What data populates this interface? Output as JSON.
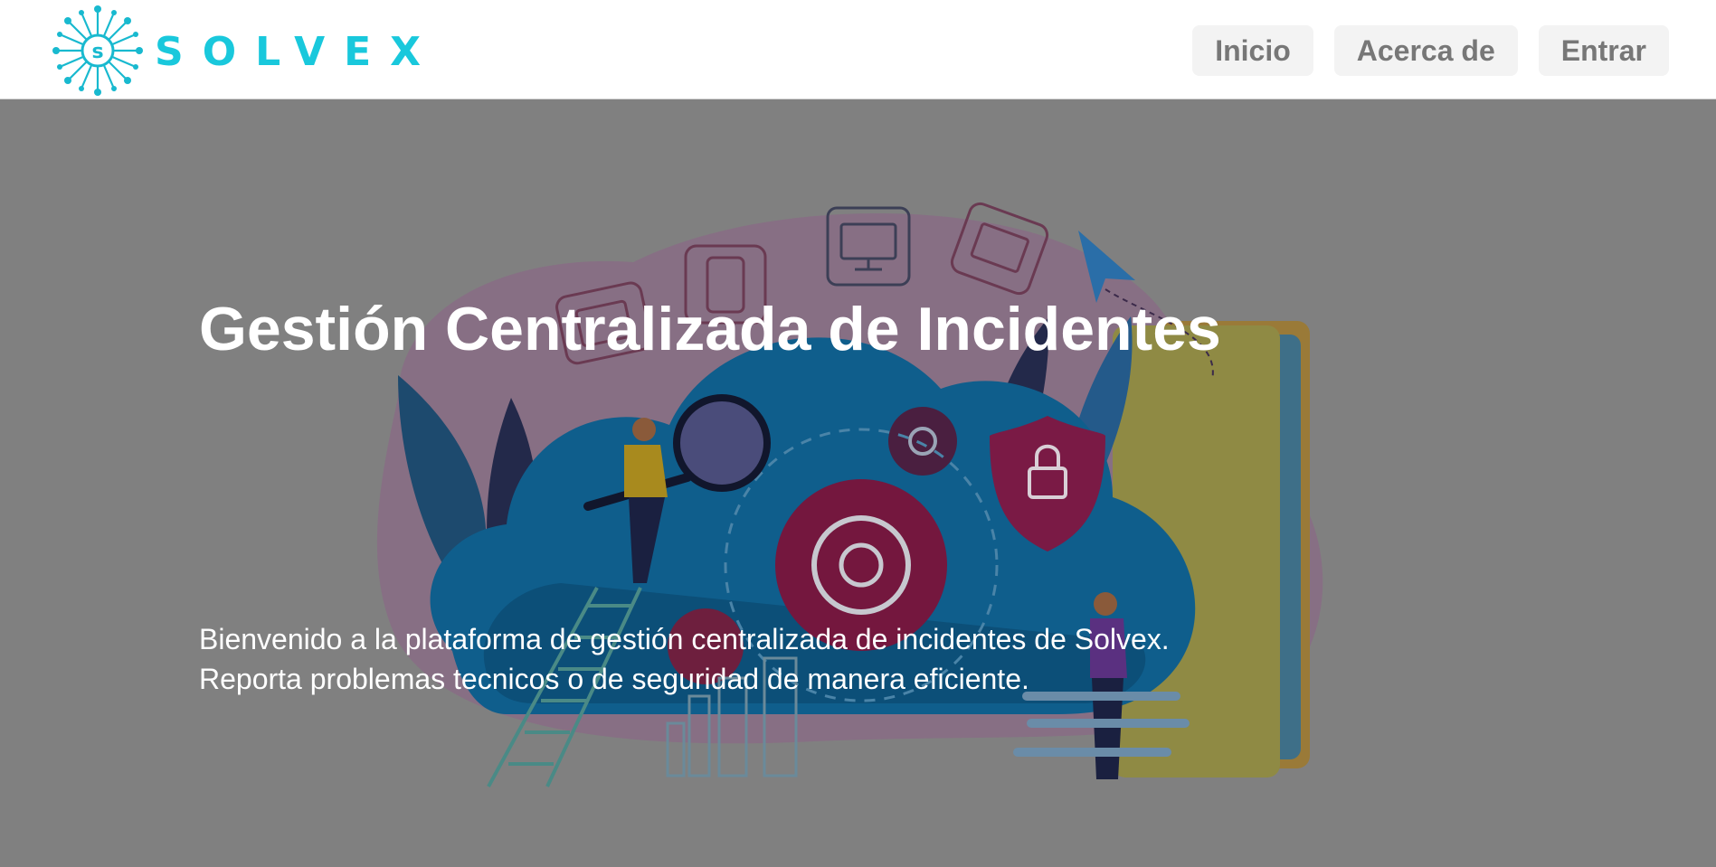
{
  "brand": {
    "name": "SOLVEX",
    "mark_letter": "s",
    "color": "#19c8dc"
  },
  "nav": {
    "items": [
      "Inicio",
      "Acerca de",
      "Entrar"
    ]
  },
  "hero": {
    "title": "Gestión Centralizada de Incidentes",
    "lines": [
      "Bienvenido a la plataforma de gestión centralizada de incidentes de Solvex.",
      "Reporta problemas tecnicos o de seguridad de manera eficiente."
    ],
    "overlay_color": "#808080"
  },
  "illustration": {
    "subject": "cloud-incident-management",
    "icons": [
      "tablet-icon",
      "smartphone-icon",
      "monitor-icon",
      "laptop-icon",
      "paper-plane-icon",
      "magnifying-glass-icon",
      "gear-icon",
      "shield-lock-icon",
      "ladder-icon",
      "bar-chart-icon",
      "folder-icon",
      "leaf-icon"
    ]
  }
}
